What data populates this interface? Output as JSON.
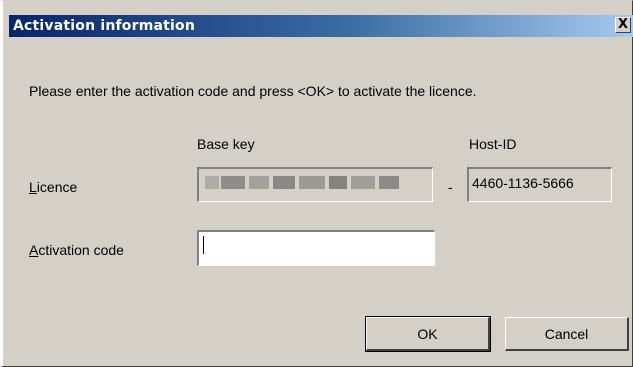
{
  "dialog": {
    "title": "Activation information",
    "close_glyph": "X",
    "instructions": "Please enter the activation code and press <OK> to activate the licence."
  },
  "columns": {
    "base_key_header": "Base key",
    "host_id_header": "Host-ID"
  },
  "licence": {
    "label_mnemonic": "L",
    "label_rest": "icence",
    "separator": "-",
    "host_id_value": "4460-1136-5666"
  },
  "activation": {
    "label_mnemonic": "A",
    "label_rest": "ctivation code",
    "value": ""
  },
  "buttons": {
    "ok_label": "OK",
    "cancel_label": "Cancel"
  },
  "colors": {
    "face": "#d4d0c8",
    "title_start": "#0a246a",
    "title_end": "#a6caf0"
  }
}
